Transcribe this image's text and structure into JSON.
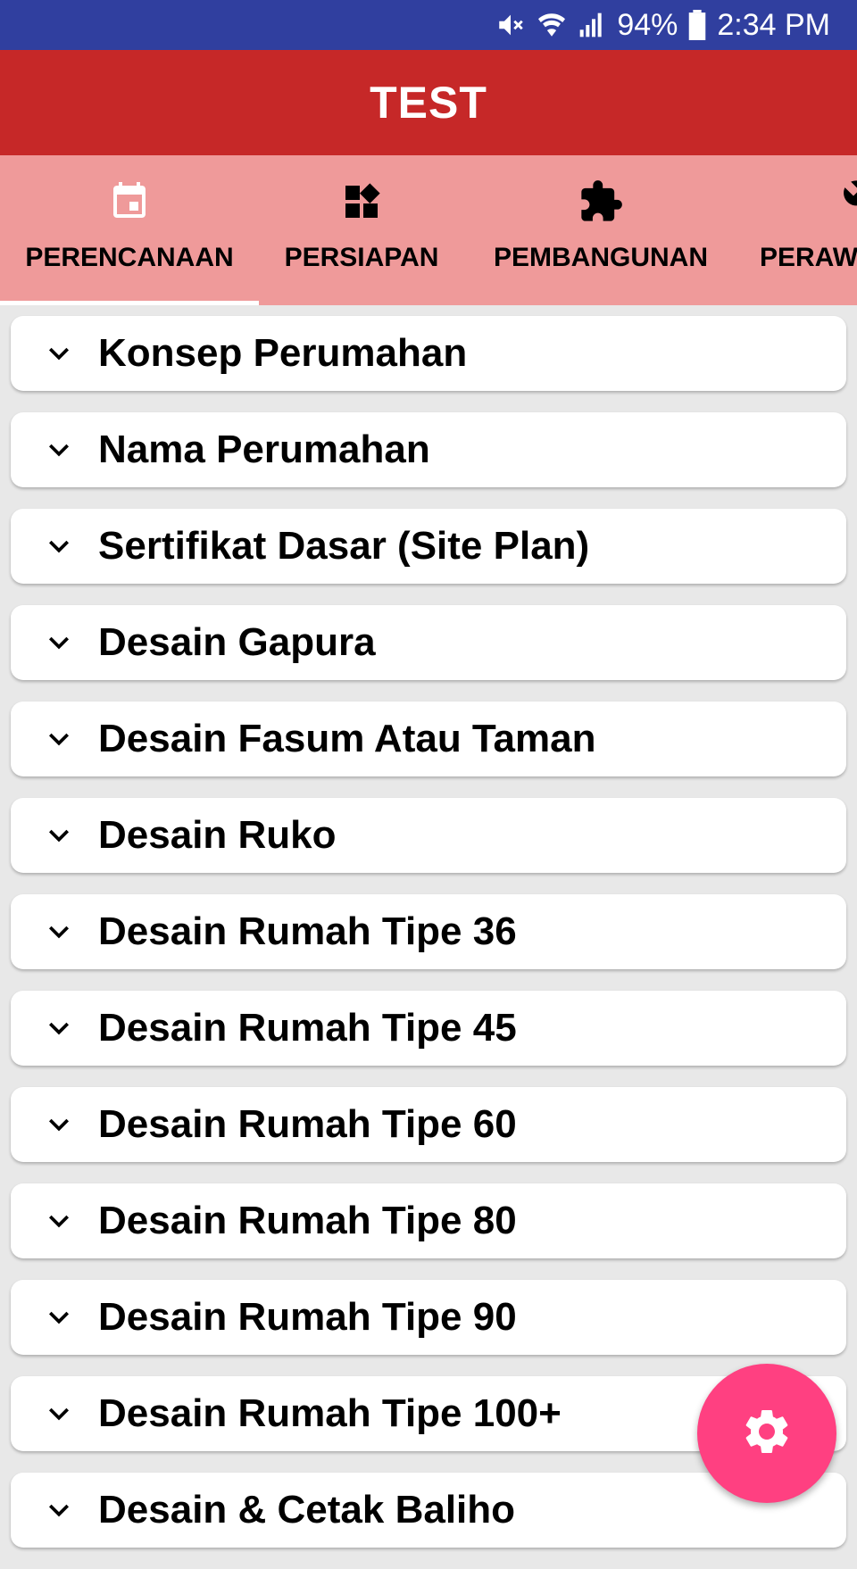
{
  "status_bar": {
    "battery": "94%",
    "time": "2:34 PM",
    "icons": [
      "mute-icon",
      "wifi-icon",
      "signal-icon",
      "battery-icon"
    ]
  },
  "app_bar": {
    "title": "TEST"
  },
  "tabs": [
    {
      "label": "PERENCANAAN",
      "icon": "calendar-icon",
      "selected": true
    },
    {
      "label": "PERSIAPAN",
      "icon": "widgets-icon",
      "selected": false
    },
    {
      "label": "PEMBANGUNAN",
      "icon": "puzzle-icon",
      "selected": false
    },
    {
      "label": "PERAW",
      "icon": "wrench-icon",
      "selected": false
    }
  ],
  "items": [
    {
      "label": "Konsep Perumahan"
    },
    {
      "label": "Nama Perumahan"
    },
    {
      "label": "Sertifikat Dasar (Site Plan)"
    },
    {
      "label": "Desain Gapura"
    },
    {
      "label": "Desain Fasum Atau Taman"
    },
    {
      "label": "Desain Ruko"
    },
    {
      "label": "Desain Rumah Tipe 36"
    },
    {
      "label": "Desain Rumah Tipe 45"
    },
    {
      "label": "Desain Rumah Tipe 60"
    },
    {
      "label": "Desain Rumah Tipe 80"
    },
    {
      "label": "Desain Rumah Tipe 90"
    },
    {
      "label": "Desain Rumah Tipe 100+"
    },
    {
      "label": "Desain & Cetak Baliho"
    }
  ],
  "fab": {
    "icon": "gear-icon"
  },
  "colors": {
    "status_bar": "#303f9f",
    "app_bar": "#c62828",
    "tab_bar": "#ef9a9a",
    "fab": "#ff4081",
    "background": "#e8e8e8"
  }
}
